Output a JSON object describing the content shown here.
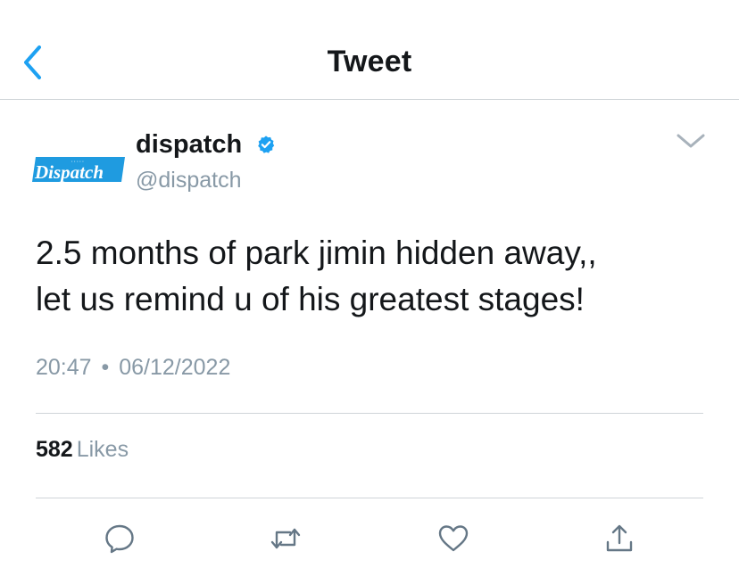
{
  "header": {
    "title": "Tweet",
    "back_icon": "chevron-left-icon"
  },
  "colors": {
    "accent": "#1da1f2",
    "text": "#14171a",
    "secondary": "#8899a6",
    "divider": "#cfd4d8"
  },
  "author": {
    "display_name": "dispatch",
    "handle": "@dispatch",
    "verified": true,
    "avatar_logo_text": "Dispatch"
  },
  "tweet": {
    "text_line1": "2.5 months of park jimin hidden away,,",
    "text_line2": "let us remind u of his greatest stages!",
    "time": "20:47",
    "separator": "•",
    "date": "06/12/2022"
  },
  "stats": {
    "likes_count": "582",
    "likes_label": "Likes"
  },
  "actions": [
    "reply-icon",
    "retweet-icon",
    "like-icon",
    "share-icon"
  ]
}
